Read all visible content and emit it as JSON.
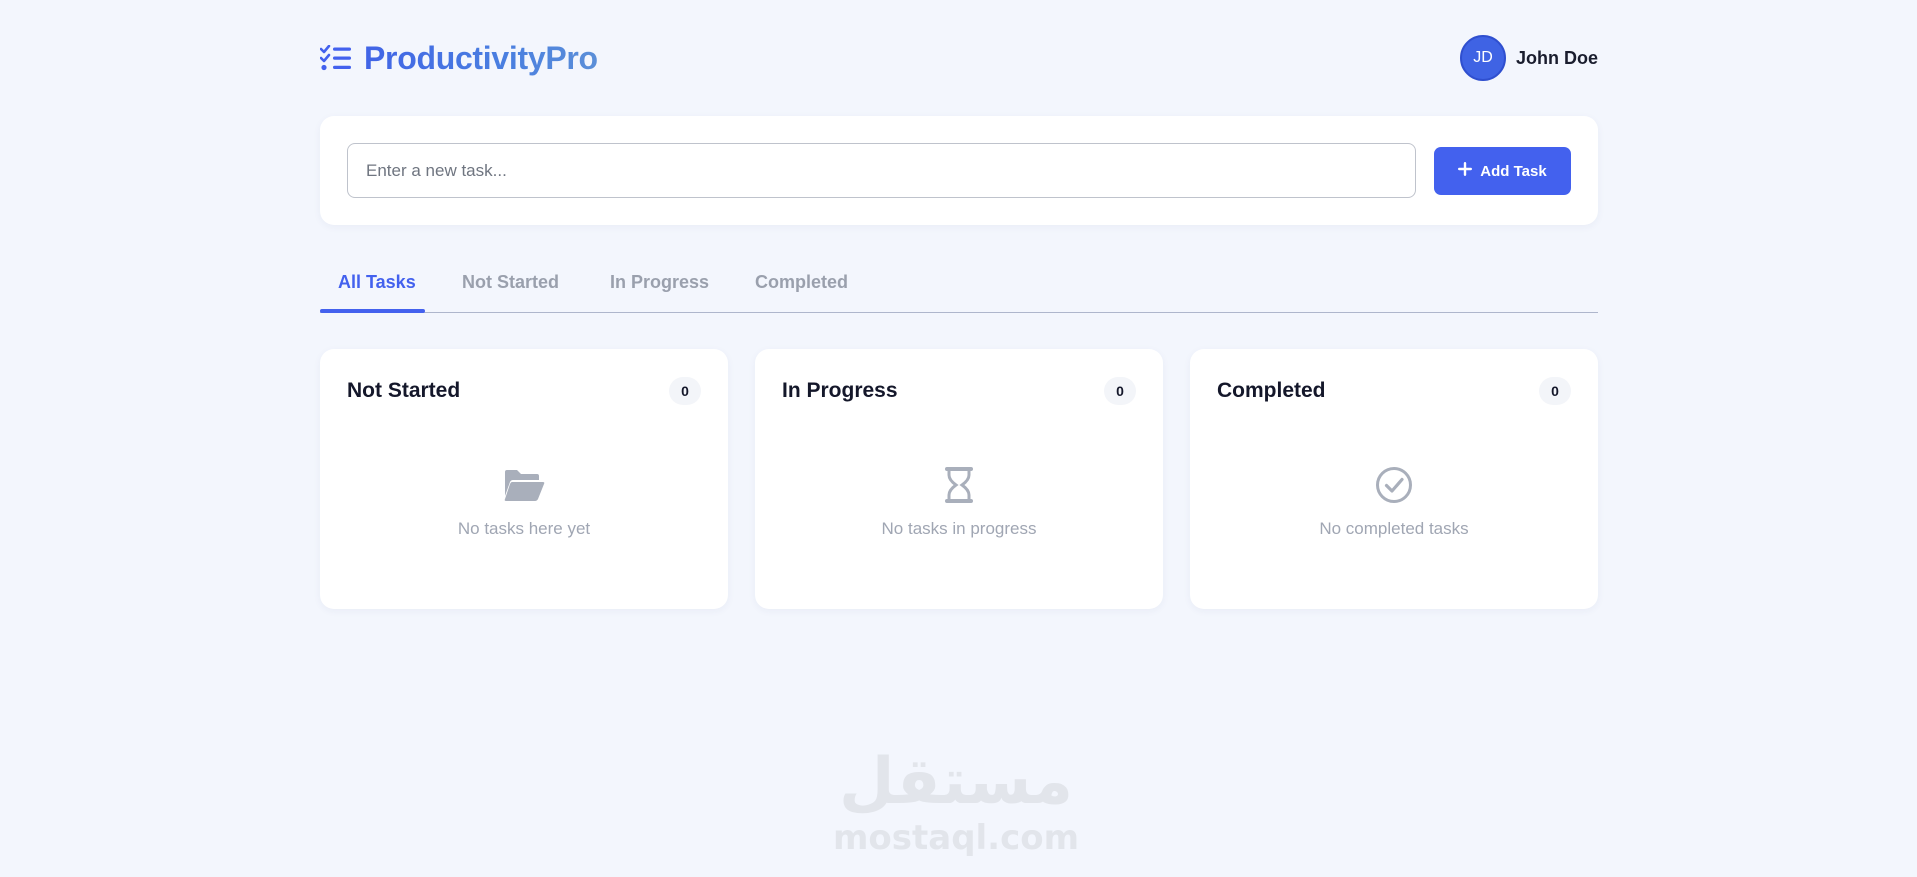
{
  "app": {
    "brand_name": "ProductivityPro",
    "brand_icon": "task-list-icon",
    "accent_color": "#4361ee"
  },
  "user": {
    "initials": "JD",
    "name": "John Doe"
  },
  "add_task": {
    "placeholder": "Enter a new task...",
    "value": "",
    "button_label": "Add Task",
    "button_icon": "plus-icon"
  },
  "tabs": [
    {
      "label": "All Tasks",
      "active": true
    },
    {
      "label": "Not Started",
      "active": false
    },
    {
      "label": "In Progress",
      "active": false
    },
    {
      "label": "Completed",
      "active": false
    }
  ],
  "columns": [
    {
      "title": "Not Started",
      "count": "0",
      "empty_icon": "folder-open-icon",
      "empty_text": "No tasks here yet"
    },
    {
      "title": "In Progress",
      "count": "0",
      "empty_icon": "hourglass-icon",
      "empty_text": "No tasks in progress"
    },
    {
      "title": "Completed",
      "count": "0",
      "empty_icon": "check-circle-icon",
      "empty_text": "No completed tasks"
    }
  ],
  "watermark": {
    "arabic": "مستقل",
    "latin": "mostaql.com"
  }
}
